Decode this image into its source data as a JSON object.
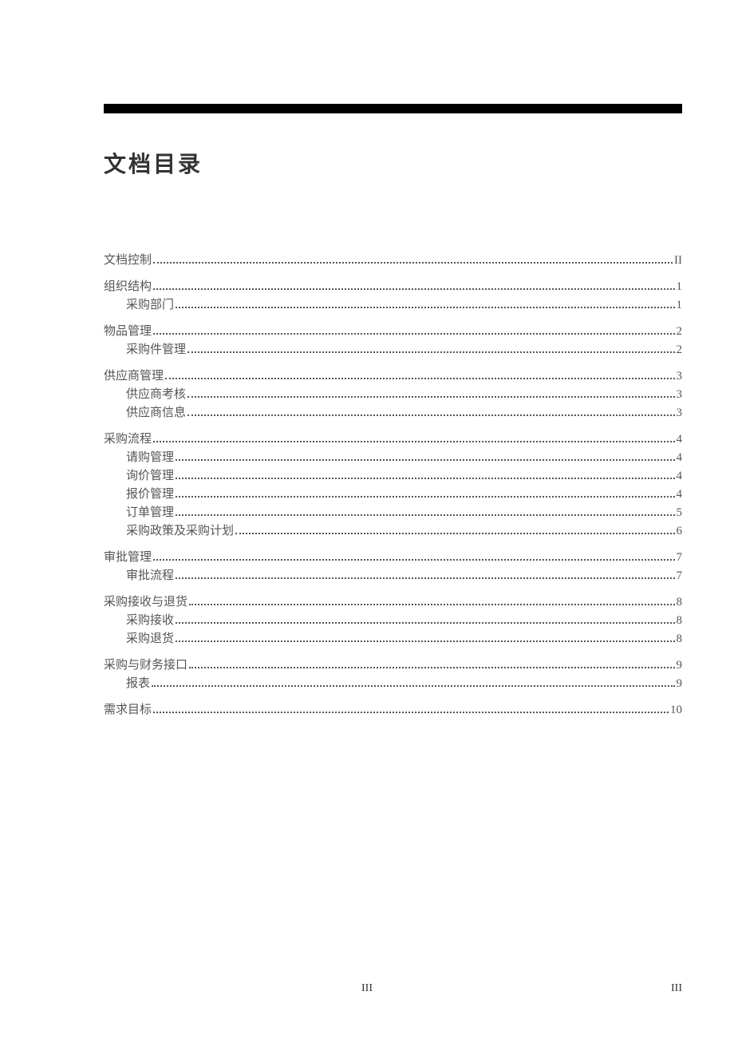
{
  "title": "文档目录",
  "toc": [
    {
      "label": "文档控制",
      "page": "II",
      "children": []
    },
    {
      "label": "组织结构",
      "page": "1",
      "children": [
        {
          "label": "采购部门",
          "page": "1"
        }
      ]
    },
    {
      "label": "物品管理",
      "page": "2",
      "children": [
        {
          "label": "采购件管理",
          "page": "2"
        }
      ]
    },
    {
      "label": "供应商管理",
      "page": "3",
      "children": [
        {
          "label": "供应商考核",
          "page": "3"
        },
        {
          "label": "供应商信息",
          "page": "3"
        }
      ]
    },
    {
      "label": "采购流程",
      "page": "4",
      "children": [
        {
          "label": "请购管理",
          "page": "4"
        },
        {
          "label": "询价管理",
          "page": "4"
        },
        {
          "label": "报价管理",
          "page": "4"
        },
        {
          "label": "订单管理",
          "page": "5"
        },
        {
          "label": "采购政策及采购计划",
          "page": "6"
        }
      ]
    },
    {
      "label": "审批管理",
      "page": "7",
      "children": [
        {
          "label": "审批流程",
          "page": "7"
        }
      ]
    },
    {
      "label": "采购接收与退货",
      "page": "8",
      "children": [
        {
          "label": "采购接收",
          "page": "8"
        },
        {
          "label": "采购退货",
          "page": "8"
        }
      ]
    },
    {
      "label": "采购与财务接口",
      "page": "9",
      "children": [
        {
          "label": "报表",
          "page": "9"
        }
      ]
    },
    {
      "label": "需求目标",
      "page": "10",
      "children": []
    }
  ],
  "footer": {
    "center": "III",
    "right": "III"
  }
}
